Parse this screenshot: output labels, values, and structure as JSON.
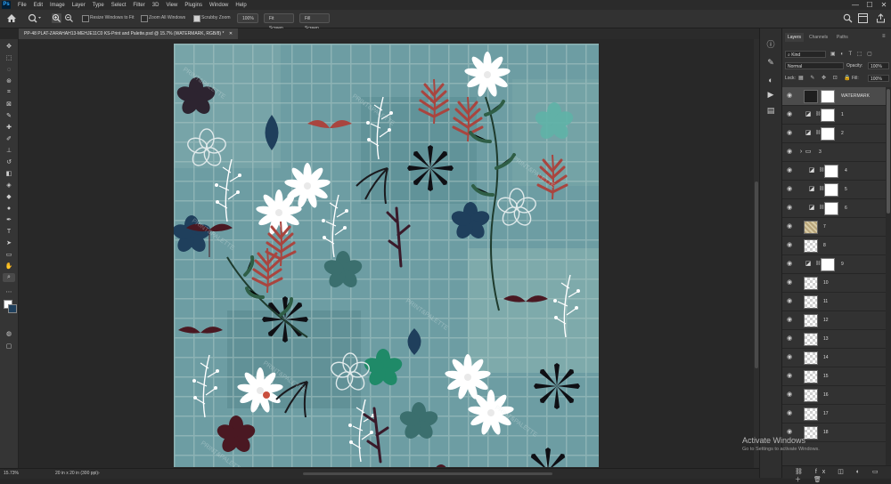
{
  "menubar": {
    "logo": "Ps",
    "items": [
      "File",
      "Edit",
      "Image",
      "Layer",
      "Type",
      "Select",
      "Filter",
      "3D",
      "View",
      "Plugins",
      "Window",
      "Help"
    ],
    "window_controls": [
      "—",
      "☐",
      "✕"
    ]
  },
  "options": {
    "resize_windows_label": "Resize Windows to Fit",
    "zoom_all_windows_label": "Zoom All Windows",
    "scrubby_zoom_label": "Scrubby Zoom",
    "zoom_100_label": "100%",
    "fit_screen_label": "Fit Screen",
    "fill_screen_label": "Fill Screen"
  },
  "document": {
    "tab_title": "PP-48 PLAT-ZARAHAH13-MEHJE11C0 KS-Print and Palette.psd @ 15.7% (WATERMARK, RGB/8) *"
  },
  "status": {
    "zoom": "15.73%",
    "doc_size": "20 in x 20 in (300 ppi)"
  },
  "panels": {
    "tabs": [
      "Layers",
      "Channels",
      "Paths"
    ],
    "filter_kind": "Kind",
    "blend_mode": "Normal",
    "opacity_label": "Opacity:",
    "opacity_value": "100%",
    "lock_label": "Lock:",
    "fill_label": "Fill:",
    "fill_value": "100%"
  },
  "layers": [
    {
      "name": "WATERMARK",
      "thumb": "dark",
      "mask": true,
      "selected": true
    },
    {
      "name": "1",
      "thumb": "adj",
      "mask": true
    },
    {
      "name": "2",
      "thumb": "adj",
      "mask": true
    },
    {
      "name": "3",
      "thumb": "folder",
      "mask": false
    },
    {
      "name": "4",
      "thumb": "adj",
      "mask": true,
      "indent": true
    },
    {
      "name": "5",
      "thumb": "adj",
      "mask": true,
      "indent": true
    },
    {
      "name": "6",
      "thumb": "adj",
      "mask": true,
      "indent": true
    },
    {
      "name": "7",
      "thumb": "texture",
      "mask": false
    },
    {
      "name": "8",
      "thumb": "checker",
      "mask": false
    },
    {
      "name": "9",
      "thumb": "adj",
      "mask": true
    },
    {
      "name": "10",
      "thumb": "checker",
      "mask": false
    },
    {
      "name": "11",
      "thumb": "checker",
      "mask": false
    },
    {
      "name": "12",
      "thumb": "checker",
      "mask": false
    },
    {
      "name": "13",
      "thumb": "checker",
      "mask": false
    },
    {
      "name": "14",
      "thumb": "checker",
      "mask": false
    },
    {
      "name": "15",
      "thumb": "checker",
      "mask": false
    },
    {
      "name": "16",
      "thumb": "checker",
      "mask": false
    },
    {
      "name": "17",
      "thumb": "checker",
      "mask": false
    },
    {
      "name": "18",
      "thumb": "checker",
      "mask": false
    }
  ],
  "os_watermark": {
    "line1": "Activate Windows",
    "line2": "Go to Settings to activate Windows."
  },
  "colors": {
    "fabric_base": "#6d9da3",
    "accent_teal": "#5fb3a8",
    "rust": "#a9453f",
    "navy": "#1f3f5c",
    "burgundy": "#4a1822",
    "emerald": "#1f8a68"
  }
}
